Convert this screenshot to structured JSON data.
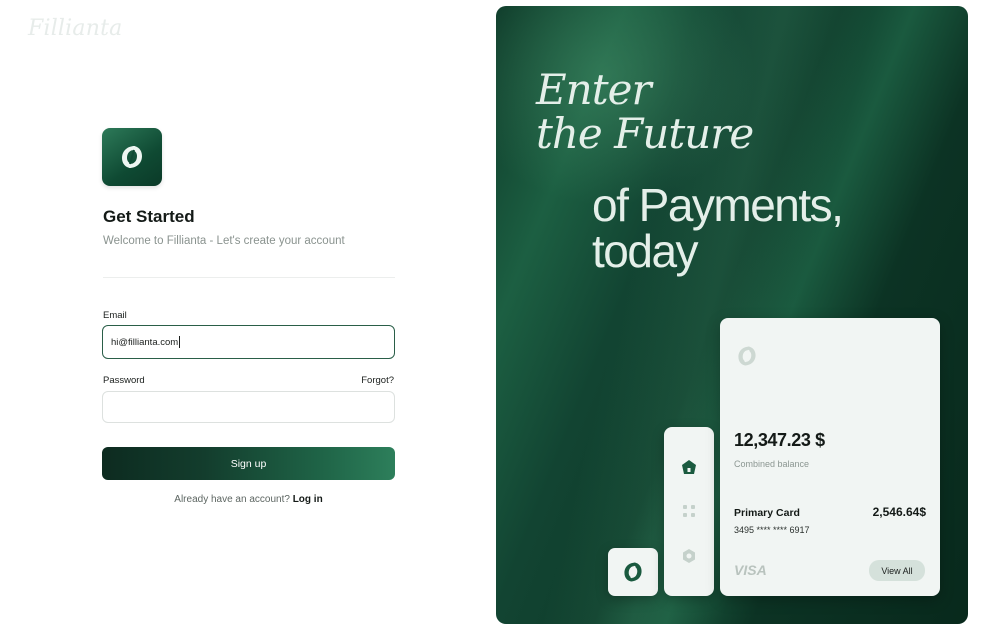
{
  "app": {
    "brand": "Fillianta"
  },
  "form": {
    "title": "Get Started",
    "subtitle": "Welcome to Fillianta - Let's create your account",
    "email_label": "Email",
    "email_value": "hi@fillianta.com",
    "password_label": "Password",
    "forgot_label": "Forgot?",
    "signup_label": "Sign up",
    "account_prompt": "Already have an account?",
    "login_label": "Log in"
  },
  "hero": {
    "line1": "Enter",
    "line2": "the Future",
    "line3": "of Payments,",
    "line4": "today"
  },
  "card": {
    "balance": "12,347.23 $",
    "balance_label": "Combined balance",
    "primary_title": "Primary Card",
    "primary_amount": "2,546.64$",
    "card_number": "3495 **** **** 6917",
    "network": "VISA",
    "view_all_label": "View All"
  },
  "icons": {
    "logo": "fillianta-logo-icon",
    "home": "home-icon",
    "grid": "grid-icon",
    "settings": "settings-icon"
  },
  "colors": {
    "brand_dark": "#0f4a33",
    "brand_light": "#2d7f5b",
    "card_bg": "#f1f5f3"
  }
}
